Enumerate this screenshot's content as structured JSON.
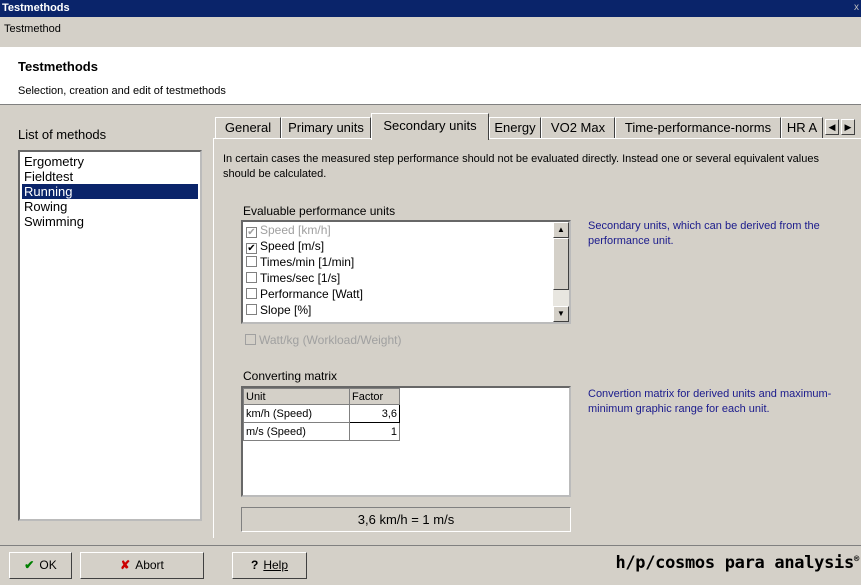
{
  "window": {
    "title": "Testmethods",
    "close_glyph": "x"
  },
  "menu": {
    "label": "Testmethod"
  },
  "header": {
    "title": "Testmethods",
    "subtitle": "Selection, creation and edit of testmethods"
  },
  "methods": {
    "label": "List of methods",
    "items": [
      "Ergometry",
      "Fieldtest",
      "Running",
      "Rowing",
      "Swimming"
    ],
    "selected": "Running"
  },
  "tabs": {
    "items": [
      "General",
      "Primary units",
      "Secondary units",
      "Energy",
      "VO2 Max",
      "Time-performance-norms",
      "HR A"
    ],
    "active": "Secondary units",
    "scroll_left_glyph": "◀",
    "scroll_right_glyph": "▶"
  },
  "secondary": {
    "description": "In certain cases the measured step performance should not be evaluated directly. Instead one or several equivalent values should be calculated.",
    "evaluable_label": "Evaluable performance units",
    "units": [
      {
        "label": "Speed [km/h]",
        "checked": true,
        "disabled": true
      },
      {
        "label": "Speed [m/s]",
        "checked": true,
        "disabled": false
      },
      {
        "label": "Times/min [1/min]",
        "checked": false,
        "disabled": false
      },
      {
        "label": "Times/sec [1/s]",
        "checked": false,
        "disabled": false
      },
      {
        "label": "Performance [Watt]",
        "checked": false,
        "disabled": false
      },
      {
        "label": "Slope [%]",
        "checked": false,
        "disabled": false
      }
    ],
    "units_note": "Secondary units, which can be derived from the performance unit.",
    "wattkg_label": "Watt/kg (Workload/Weight)",
    "wattkg_checked": false,
    "matrix_label": "Converting matrix",
    "matrix_note": "Convertion matrix for derived units and maximum-minimum graphic range for each unit.",
    "matrix_columns": [
      "Unit",
      "Factor"
    ],
    "matrix_rows": [
      {
        "unit": "km/h (Speed)",
        "factor": "3,6"
      },
      {
        "unit": "m/s (Speed)",
        "factor": "1"
      }
    ],
    "result": "3,6 km/h = 1 m/s"
  },
  "buttons": {
    "ok": {
      "label": "OK",
      "icon": "check-icon",
      "glyph": "✔"
    },
    "abort": {
      "label": "Abort",
      "icon": "x-icon",
      "glyph": "✘"
    },
    "help": {
      "label": "Help",
      "icon": "question-icon",
      "glyph": "?"
    }
  },
  "brand": {
    "text": "h/p/cosmos para analysis",
    "mark": "®"
  },
  "colors": {
    "selection": "#0a246a",
    "note_text": "#1a1a8c",
    "ok_icon": "#008000",
    "abort_icon": "#cc0000"
  }
}
